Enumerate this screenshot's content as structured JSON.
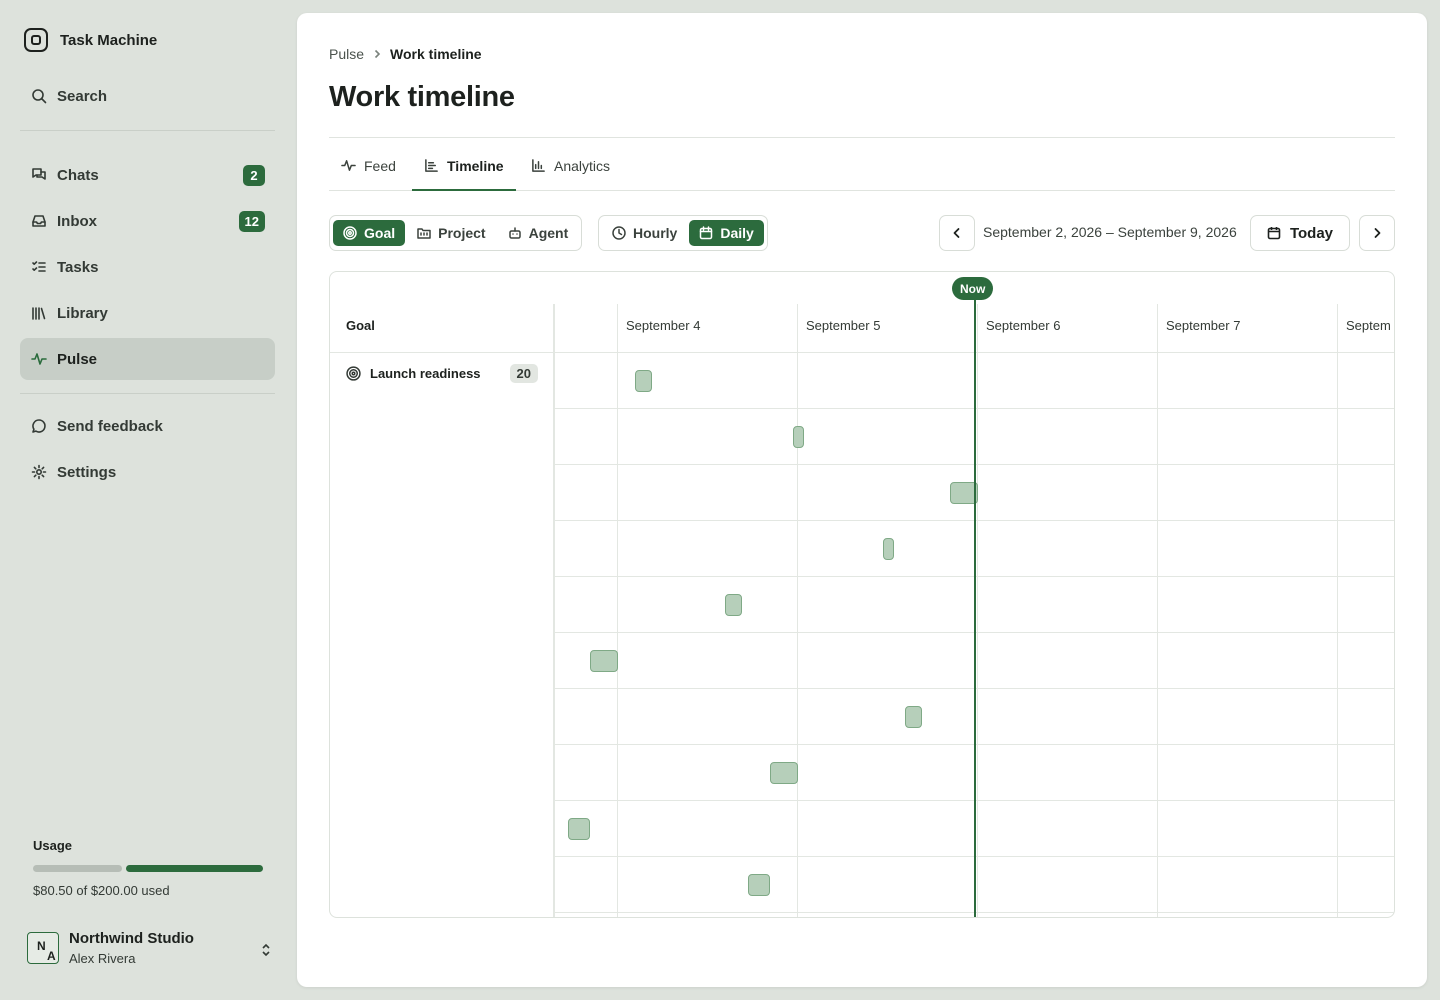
{
  "app": {
    "name": "Task Machine"
  },
  "sidebar": {
    "search_label": "Search",
    "items": [
      {
        "label": "Chats",
        "badge": "2",
        "icon": "chats-icon"
      },
      {
        "label": "Inbox",
        "badge": "12",
        "icon": "inbox-icon"
      },
      {
        "label": "Tasks",
        "badge": null,
        "icon": "tasks-icon"
      },
      {
        "label": "Library",
        "badge": null,
        "icon": "library-icon"
      },
      {
        "label": "Pulse",
        "badge": null,
        "icon": "pulse-icon",
        "active": true
      }
    ],
    "secondary": [
      {
        "label": "Send feedback",
        "icon": "feedback-icon"
      },
      {
        "label": "Settings",
        "icon": "gear-icon"
      }
    ],
    "usage": {
      "title": "Usage",
      "text": "$80.50 of $200.00 used",
      "used": 80.5,
      "limit": 200
    },
    "account": {
      "org": "Northwind Studio",
      "user": "Alex Rivera",
      "avatar_initials_1": "N",
      "avatar_initials_2": "A"
    }
  },
  "header": {
    "breadcrumb": [
      "Pulse",
      "Work timeline"
    ],
    "title": "Work timeline"
  },
  "tabs": [
    {
      "label": "Feed",
      "icon": "activity-icon"
    },
    {
      "label": "Timeline",
      "icon": "timeline-icon",
      "active": true
    },
    {
      "label": "Analytics",
      "icon": "bar-chart-icon"
    }
  ],
  "toolbar": {
    "group_by": [
      {
        "label": "Goal",
        "icon": "target-icon",
        "on": true
      },
      {
        "label": "Project",
        "icon": "folder-icon",
        "on": false
      },
      {
        "label": "Agent",
        "icon": "robot-icon",
        "on": false
      }
    ],
    "granularity": [
      {
        "label": "Hourly",
        "icon": "clock-icon",
        "on": false
      },
      {
        "label": "Daily",
        "icon": "calendar-icon",
        "on": true
      }
    ],
    "range": "September 2, 2026 – September 9, 2026",
    "today_label": "Today"
  },
  "timeline": {
    "group_column_label": "Goal",
    "now_label": "Now",
    "days": [
      "September 4",
      "September 5",
      "September 6",
      "September 7",
      "Septem"
    ],
    "group": {
      "name": "Launch readiness",
      "count": "20"
    }
  },
  "colors": {
    "accent": "#2c6b3d",
    "bar_fill": "#b6cfba",
    "sidebar_bg": "#dde2dc"
  }
}
